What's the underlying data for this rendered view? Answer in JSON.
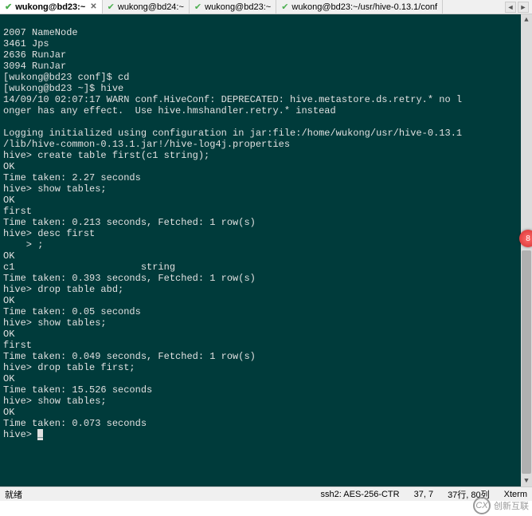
{
  "tabs": {
    "active": 0,
    "items": [
      {
        "label": "wukong@bd23:~",
        "closeable": true
      },
      {
        "label": "wukong@bd24:~"
      },
      {
        "label": "wukong@bd23:~"
      },
      {
        "label": "wukong@bd23:~/usr/hive-0.13.1/conf"
      }
    ]
  },
  "terminal": {
    "lines": [
      "2007 NameNode",
      "3461 Jps",
      "2636 RunJar",
      "3094 RunJar",
      "[wukong@bd23 conf]$ cd",
      "[wukong@bd23 ~]$ hive",
      "14/09/10 02:07:17 WARN conf.HiveConf: DEPRECATED: hive.metastore.ds.retry.* no l",
      "onger has any effect.  Use hive.hmshandler.retry.* instead",
      "",
      "Logging initialized using configuration in jar:file:/home/wukong/usr/hive-0.13.1",
      "/lib/hive-common-0.13.1.jar!/hive-log4j.properties",
      "hive> create table first(c1 string);",
      "OK",
      "Time taken: 2.27 seconds",
      "hive> show tables;",
      "OK",
      "first",
      "Time taken: 0.213 seconds, Fetched: 1 row(s)",
      "hive> desc first",
      "    > ;",
      "OK",
      "c1                      string",
      "Time taken: 0.393 seconds, Fetched: 1 row(s)",
      "hive> drop table abd;",
      "OK",
      "Time taken: 0.05 seconds",
      "hive> show tables;",
      "OK",
      "first",
      "Time taken: 0.049 seconds, Fetched: 1 row(s)",
      "hive> drop table first;",
      "OK",
      "Time taken: 15.526 seconds",
      "hive> show tables;",
      "OK",
      "Time taken: 0.073 seconds",
      "hive> "
    ]
  },
  "statusbar": {
    "ready": "就绪",
    "encryption": "ssh2: AES-256-CTR",
    "cursor": "37,  7",
    "size": "37行, 80列",
    "emulation": "Xterm"
  },
  "badge": {
    "value": "8"
  },
  "watermark": {
    "text": "创新互联",
    "logo": "CX"
  }
}
